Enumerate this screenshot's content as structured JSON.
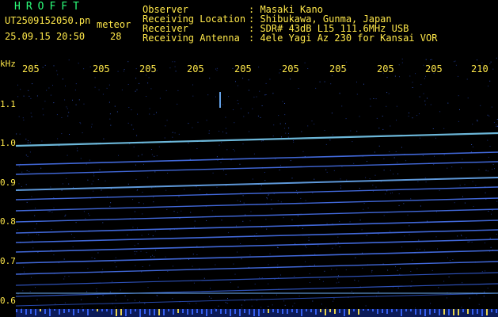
{
  "header": {
    "logo": "HROFFT",
    "file_name": "UT2509152050.pn",
    "meteor_label": "meteor",
    "datetime": "25.09.15 20:50",
    "count": "28",
    "info": [
      {
        "label": "Observer",
        "value": ": Masaki Kano"
      },
      {
        "label": "Receiving Location",
        "value": ": Shibukawa, Gunma, Japan"
      },
      {
        "label": "Receiver",
        "value": ": SDR# 43dB L15 111.6MHz USB"
      },
      {
        "label": "Receiving Antenna",
        "value": ": 4ele Yagi Az 230 for Kansai VOR"
      }
    ]
  },
  "axes": {
    "y_unit": "kHz",
    "y_ticks": [
      "1.1",
      "1.0",
      "0.9",
      "0.8",
      "0.7",
      "0.6"
    ],
    "x_ticks": [
      "205",
      "205",
      "205",
      "205",
      "205",
      "205",
      "205",
      "205",
      "205",
      "210"
    ]
  },
  "colors": {
    "background": "#000000",
    "text": "#ffe84a",
    "logo": "#2cff7a",
    "band": "#4d7bff",
    "band_bright": "#7fd8ff"
  }
}
